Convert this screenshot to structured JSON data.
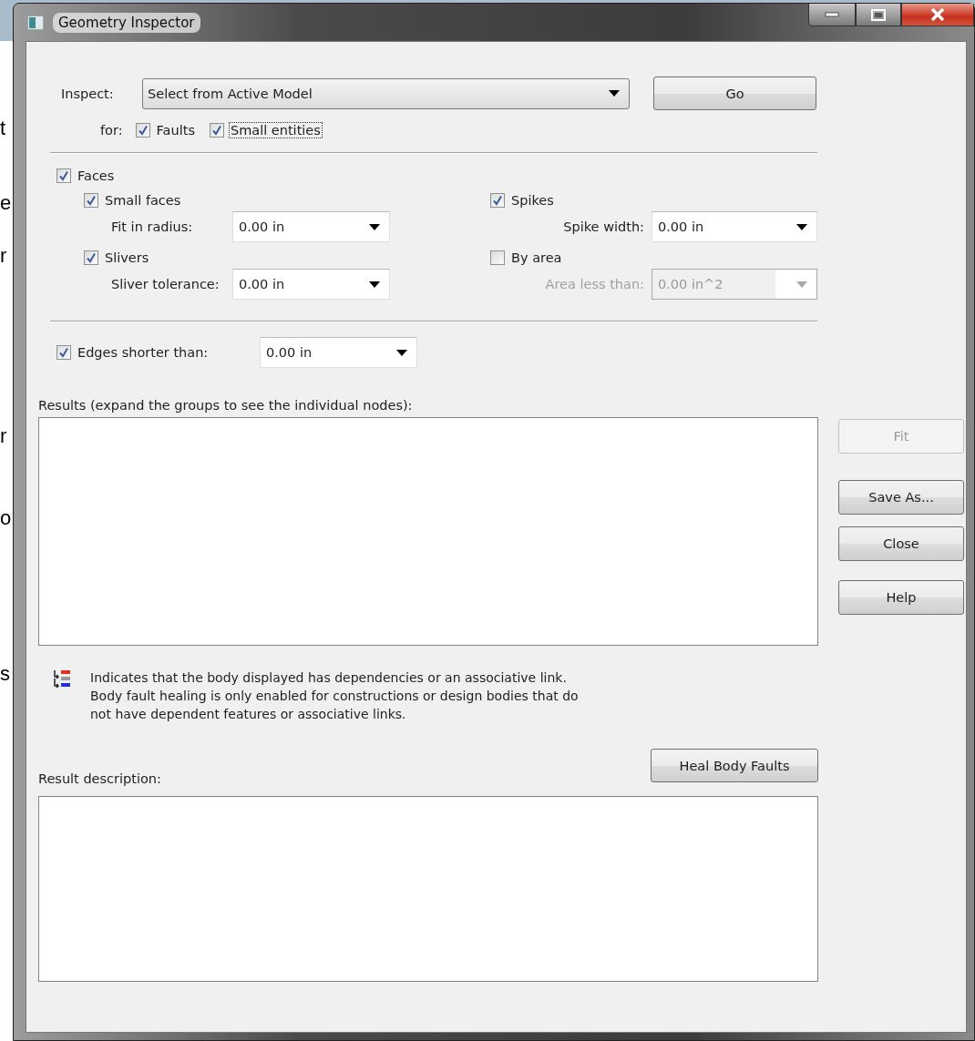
{
  "background": {
    "fragments": [
      "t",
      "e",
      "r",
      "r",
      "o",
      "s"
    ]
  },
  "window": {
    "title": "Geometry Inspector",
    "controls": [
      {
        "kind": "minimize"
      },
      {
        "kind": "maximize"
      },
      {
        "kind": "close"
      }
    ]
  },
  "inspect": {
    "label": "Inspect:",
    "value": "Select from Active Model",
    "button": {
      "label": "Go",
      "disabled": false
    }
  },
  "for": {
    "label": "for:",
    "options": [
      {
        "label": "Faults",
        "checked": true,
        "focused": false
      },
      {
        "label": "Small entities",
        "checked": true,
        "focused": true
      }
    ]
  },
  "faces": {
    "label": "Faces",
    "checked": true,
    "options": [
      {
        "label": "Small faces",
        "checked": true,
        "field": {
          "label": "Fit in radius:",
          "value": "0.00 in",
          "disabled": false
        }
      },
      {
        "label": "Spikes",
        "checked": true,
        "field": {
          "label": "Spike width:",
          "value": "0.00 in",
          "disabled": false
        }
      },
      {
        "label": "Slivers",
        "checked": true,
        "field": {
          "label": "Sliver tolerance:",
          "value": "0.00 in",
          "disabled": false
        }
      },
      {
        "label": "By area",
        "checked": false,
        "field": {
          "label": "Area less than:",
          "value": "0.00 in^2",
          "disabled": true
        }
      }
    ]
  },
  "edges": {
    "label": "Edges shorter than:",
    "checked": true,
    "value": "0.00 in",
    "disabled": false
  },
  "results": {
    "label": "Results (expand the groups to see the individual nodes):"
  },
  "side_buttons": [
    {
      "label": "Fit",
      "disabled": true
    },
    {
      "label": "Save As...",
      "disabled": false
    },
    {
      "label": "Close",
      "disabled": false
    },
    {
      "label": "Help",
      "disabled": false
    }
  ],
  "note": {
    "lines": [
      "Indicates that the body displayed has dependencies or an associative link.",
      "Body fault healing is only enabled for constructions or design bodies that do",
      "not have dependent features or associative links."
    ]
  },
  "heal_button": {
    "label": "Heal Body Faults",
    "disabled": false
  },
  "description": {
    "label": "Result description:"
  }
}
